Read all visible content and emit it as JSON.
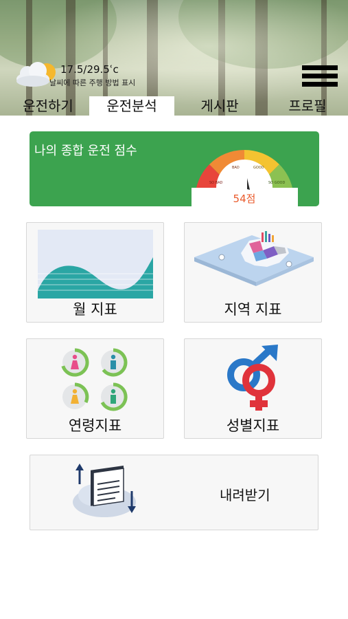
{
  "weather": {
    "icon": "partly-cloudy-icon",
    "temperature": "17.5/29.5ʿc",
    "description": "날씨에 따른 주행 방법 표시"
  },
  "menu": {
    "icon": "hamburger-menu-icon"
  },
  "tabs": [
    {
      "label": "운전하기",
      "active": false
    },
    {
      "label": "운전분석",
      "active": true
    },
    {
      "label": "게시판",
      "active": false
    },
    {
      "label": "프로필",
      "active": false
    }
  ],
  "score": {
    "title": "나의 종합 운전 점수",
    "value_label": "54점",
    "value": 54,
    "gauge_segments": [
      "SO BAD",
      "BAD",
      "GOOD",
      "SO GOOD"
    ],
    "gauge_colors": [
      "#e8453b",
      "#f08a35",
      "#f4c331",
      "#8cc152"
    ],
    "card_color": "#3ca34f",
    "value_color": "#ea5a2b"
  },
  "tiles": {
    "monthly": {
      "label": "월  지표",
      "icon": "area-chart-icon"
    },
    "region": {
      "label": "지역 지표",
      "icon": "isometric-map-icon"
    },
    "age": {
      "label": "연령지표",
      "icon": "age-group-people-icon"
    },
    "gender": {
      "label": "성별지표",
      "icon": "gender-symbols-icon"
    },
    "download": {
      "label": "내려받기",
      "icon": "cloud-document-download-icon"
    }
  }
}
